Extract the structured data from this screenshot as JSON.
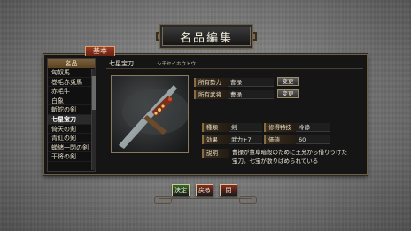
{
  "screen_title": "名品編集",
  "tab_label": "基本",
  "list": {
    "header": "名品",
    "items": [
      "匈奴馬",
      "巻毛赤兎馬",
      "赤毛牛",
      "白象",
      "斬蛇の剣",
      "七星宝刀",
      "倚天の剣",
      "青釭の剣",
      "蝉緒一閃の剣",
      "干将の剣"
    ],
    "selected_index": 5
  },
  "item": {
    "name": "七星宝刀",
    "reading": "シチセイホウトウ"
  },
  "fields": {
    "force_label": "所有勢力",
    "force_value": "曹操",
    "general_label": "所有武将",
    "general_value": "曹操",
    "change_label": "変更",
    "type_label": "種類",
    "type_value": "剣",
    "special_label": "修得特技",
    "special_value": "冷静",
    "effect_label": "効果",
    "effect_value": "武力+7",
    "price_label": "価値",
    "price_value": "60",
    "desc_label": "説明",
    "desc_line1": "曹操が董卓暗殺のために王允から借りうけた",
    "desc_line2": "宝刀。七宝が散りばめられている"
  },
  "buttons": {
    "confirm": "決定",
    "back": "戻る",
    "close": "閉"
  },
  "colors": {
    "confirm": "#2f6b2a",
    "back": "#8a2a1c",
    "close": "#8a2a1c"
  }
}
